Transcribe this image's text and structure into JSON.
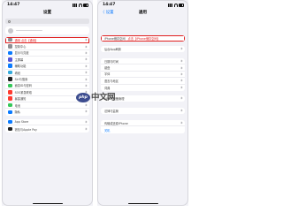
{
  "left": {
    "status_time": "14:47",
    "nav_title": "设置",
    "rows_group1": [
      {
        "label": "通用",
        "annotation": "通用 点击【通用】",
        "icon_color": "#8e8e93",
        "highlight": true
      },
      {
        "label": "控制中心",
        "icon_color": "#8e8e93"
      },
      {
        "label": "显示与亮度",
        "icon_color": "#0a7aff"
      },
      {
        "label": "主屏幕",
        "icon_color": "#5856d6"
      },
      {
        "label": "辅助功能",
        "icon_color": "#0a7aff"
      },
      {
        "label": "墙纸",
        "icon_color": "#34aadc"
      },
      {
        "label": "Siri与搜索",
        "icon_color": "#222222"
      },
      {
        "label": "面容ID与密码",
        "icon_color": "#34c759"
      },
      {
        "label": "SOS紧急联络",
        "icon_color": "#ff3b30"
      },
      {
        "label": "暴露通知",
        "icon_color": "#ff3b30"
      },
      {
        "label": "电池",
        "icon_color": "#34c759"
      },
      {
        "label": "隐私",
        "icon_color": "#0a7aff"
      }
    ],
    "rows_group2": [
      {
        "label": "App Store",
        "icon_color": "#0a7aff"
      },
      {
        "label": "钱包与Apple Pay",
        "icon_color": "#222222"
      }
    ]
  },
  "right": {
    "status_time": "14:47",
    "back_label": "〈 设置",
    "nav_title": "通用",
    "group1": [
      {
        "label": "iPhone储存空间",
        "annotation": "点击【iPhone储存空间】",
        "highlight": true
      }
    ],
    "group2": [
      {
        "label": "后台App刷新"
      }
    ],
    "group3": [
      {
        "label": "日期与时间"
      },
      {
        "label": "键盘"
      },
      {
        "label": "字体"
      },
      {
        "label": "语言与地区"
      },
      {
        "label": "词典"
      }
    ],
    "group4": [
      {
        "label": "VPN与设备管理"
      }
    ],
    "group5": [
      {
        "label": "法律与监管"
      }
    ],
    "group6": [
      {
        "label": "传输或还原iPhone"
      },
      {
        "label": "关机"
      }
    ]
  },
  "watermark": {
    "logo": "php",
    "text": "中文网"
  }
}
